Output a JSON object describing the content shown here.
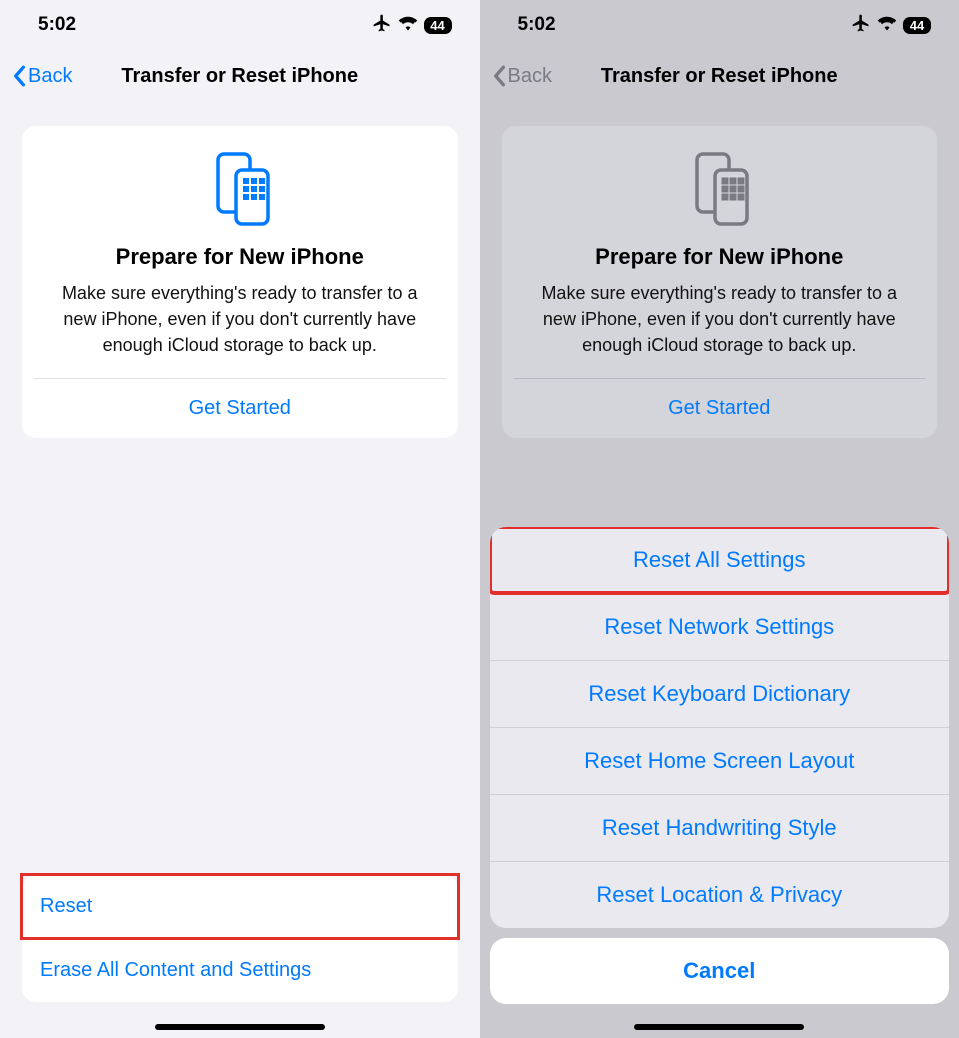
{
  "status": {
    "time": "5:02",
    "battery": "44"
  },
  "nav": {
    "back": "Back",
    "title": "Transfer or Reset iPhone"
  },
  "card": {
    "title": "Prepare for New iPhone",
    "body": "Make sure everything's ready to transfer to a new iPhone, even if you don't currently have enough iCloud storage to back up.",
    "action": "Get Started"
  },
  "left_list": {
    "reset": "Reset",
    "erase": "Erase All Content and Settings"
  },
  "sheet": {
    "items": [
      "Reset All Settings",
      "Reset Network Settings",
      "Reset Keyboard Dictionary",
      "Reset Home Screen Layout",
      "Reset Handwriting Style",
      "Reset Location & Privacy"
    ],
    "cancel": "Cancel"
  }
}
